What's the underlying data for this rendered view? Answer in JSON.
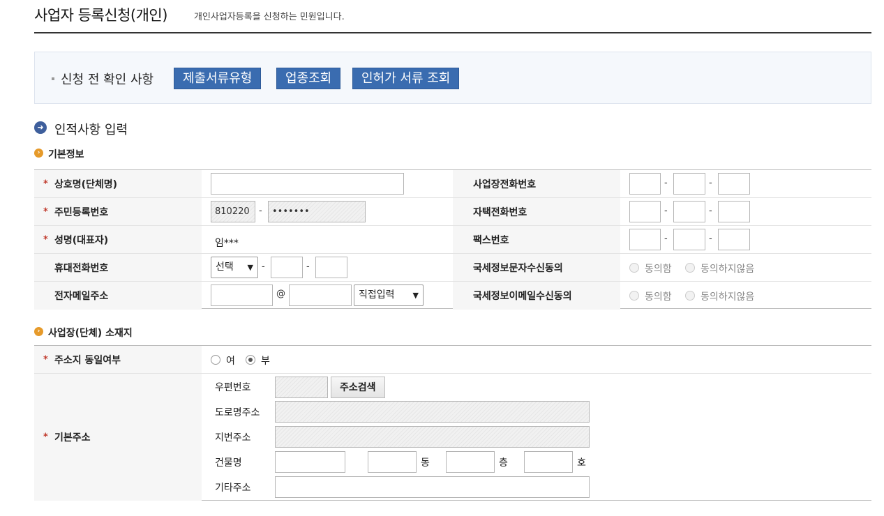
{
  "header": {
    "title": "사업자 등록신청(개인)",
    "description": "개인사업자등록을 신청하는 민원입니다."
  },
  "precheck": {
    "label": "신청 전 확인 사항",
    "buttons": [
      "제출서류유형",
      "업종조회",
      "인허가 서류 조회"
    ]
  },
  "personal_section": {
    "title": "인적사항 입력",
    "icon": "arrow-circle-icon",
    "basic_info": {
      "title": "기본정보",
      "rows": [
        {
          "label": "상호명(단체명)",
          "required": true
        },
        {
          "label": "주민등록번호",
          "required": true
        },
        {
          "label": "성명(대표자)",
          "required": true
        },
        {
          "label": "휴대전화번호",
          "required": false
        },
        {
          "label": "전자메일주소",
          "required": false
        }
      ],
      "right_labels": [
        "사업장전화번호",
        "자택전화번호",
        "팩스번호",
        "국세정보문자수신동의",
        "국세정보이메일수신동의"
      ],
      "resident_front": "810220",
      "resident_back_masked": "•••••••",
      "representative_name": "임***",
      "mobile_prefix_select": "선택",
      "email_at": "@",
      "email_domain_select": "직접입력",
      "dash": "-",
      "consent_yes": "동의함",
      "consent_no": "동의하지않음"
    }
  },
  "location_section": {
    "title": "사업장(단체) 소재지",
    "same_address_label": "주소지 동일여부",
    "yes_label": "여",
    "no_label": "부",
    "selected": "부",
    "base_address_label": "기본주소",
    "postal_code_label": "우편번호",
    "search_button": "주소검색",
    "road_address_label": "도로명주소",
    "lot_address_label": "지번주소",
    "building_label": "건물명",
    "dong_label": "동",
    "floor_label": "층",
    "ho_label": "호",
    "other_address_label": "기타주소"
  }
}
